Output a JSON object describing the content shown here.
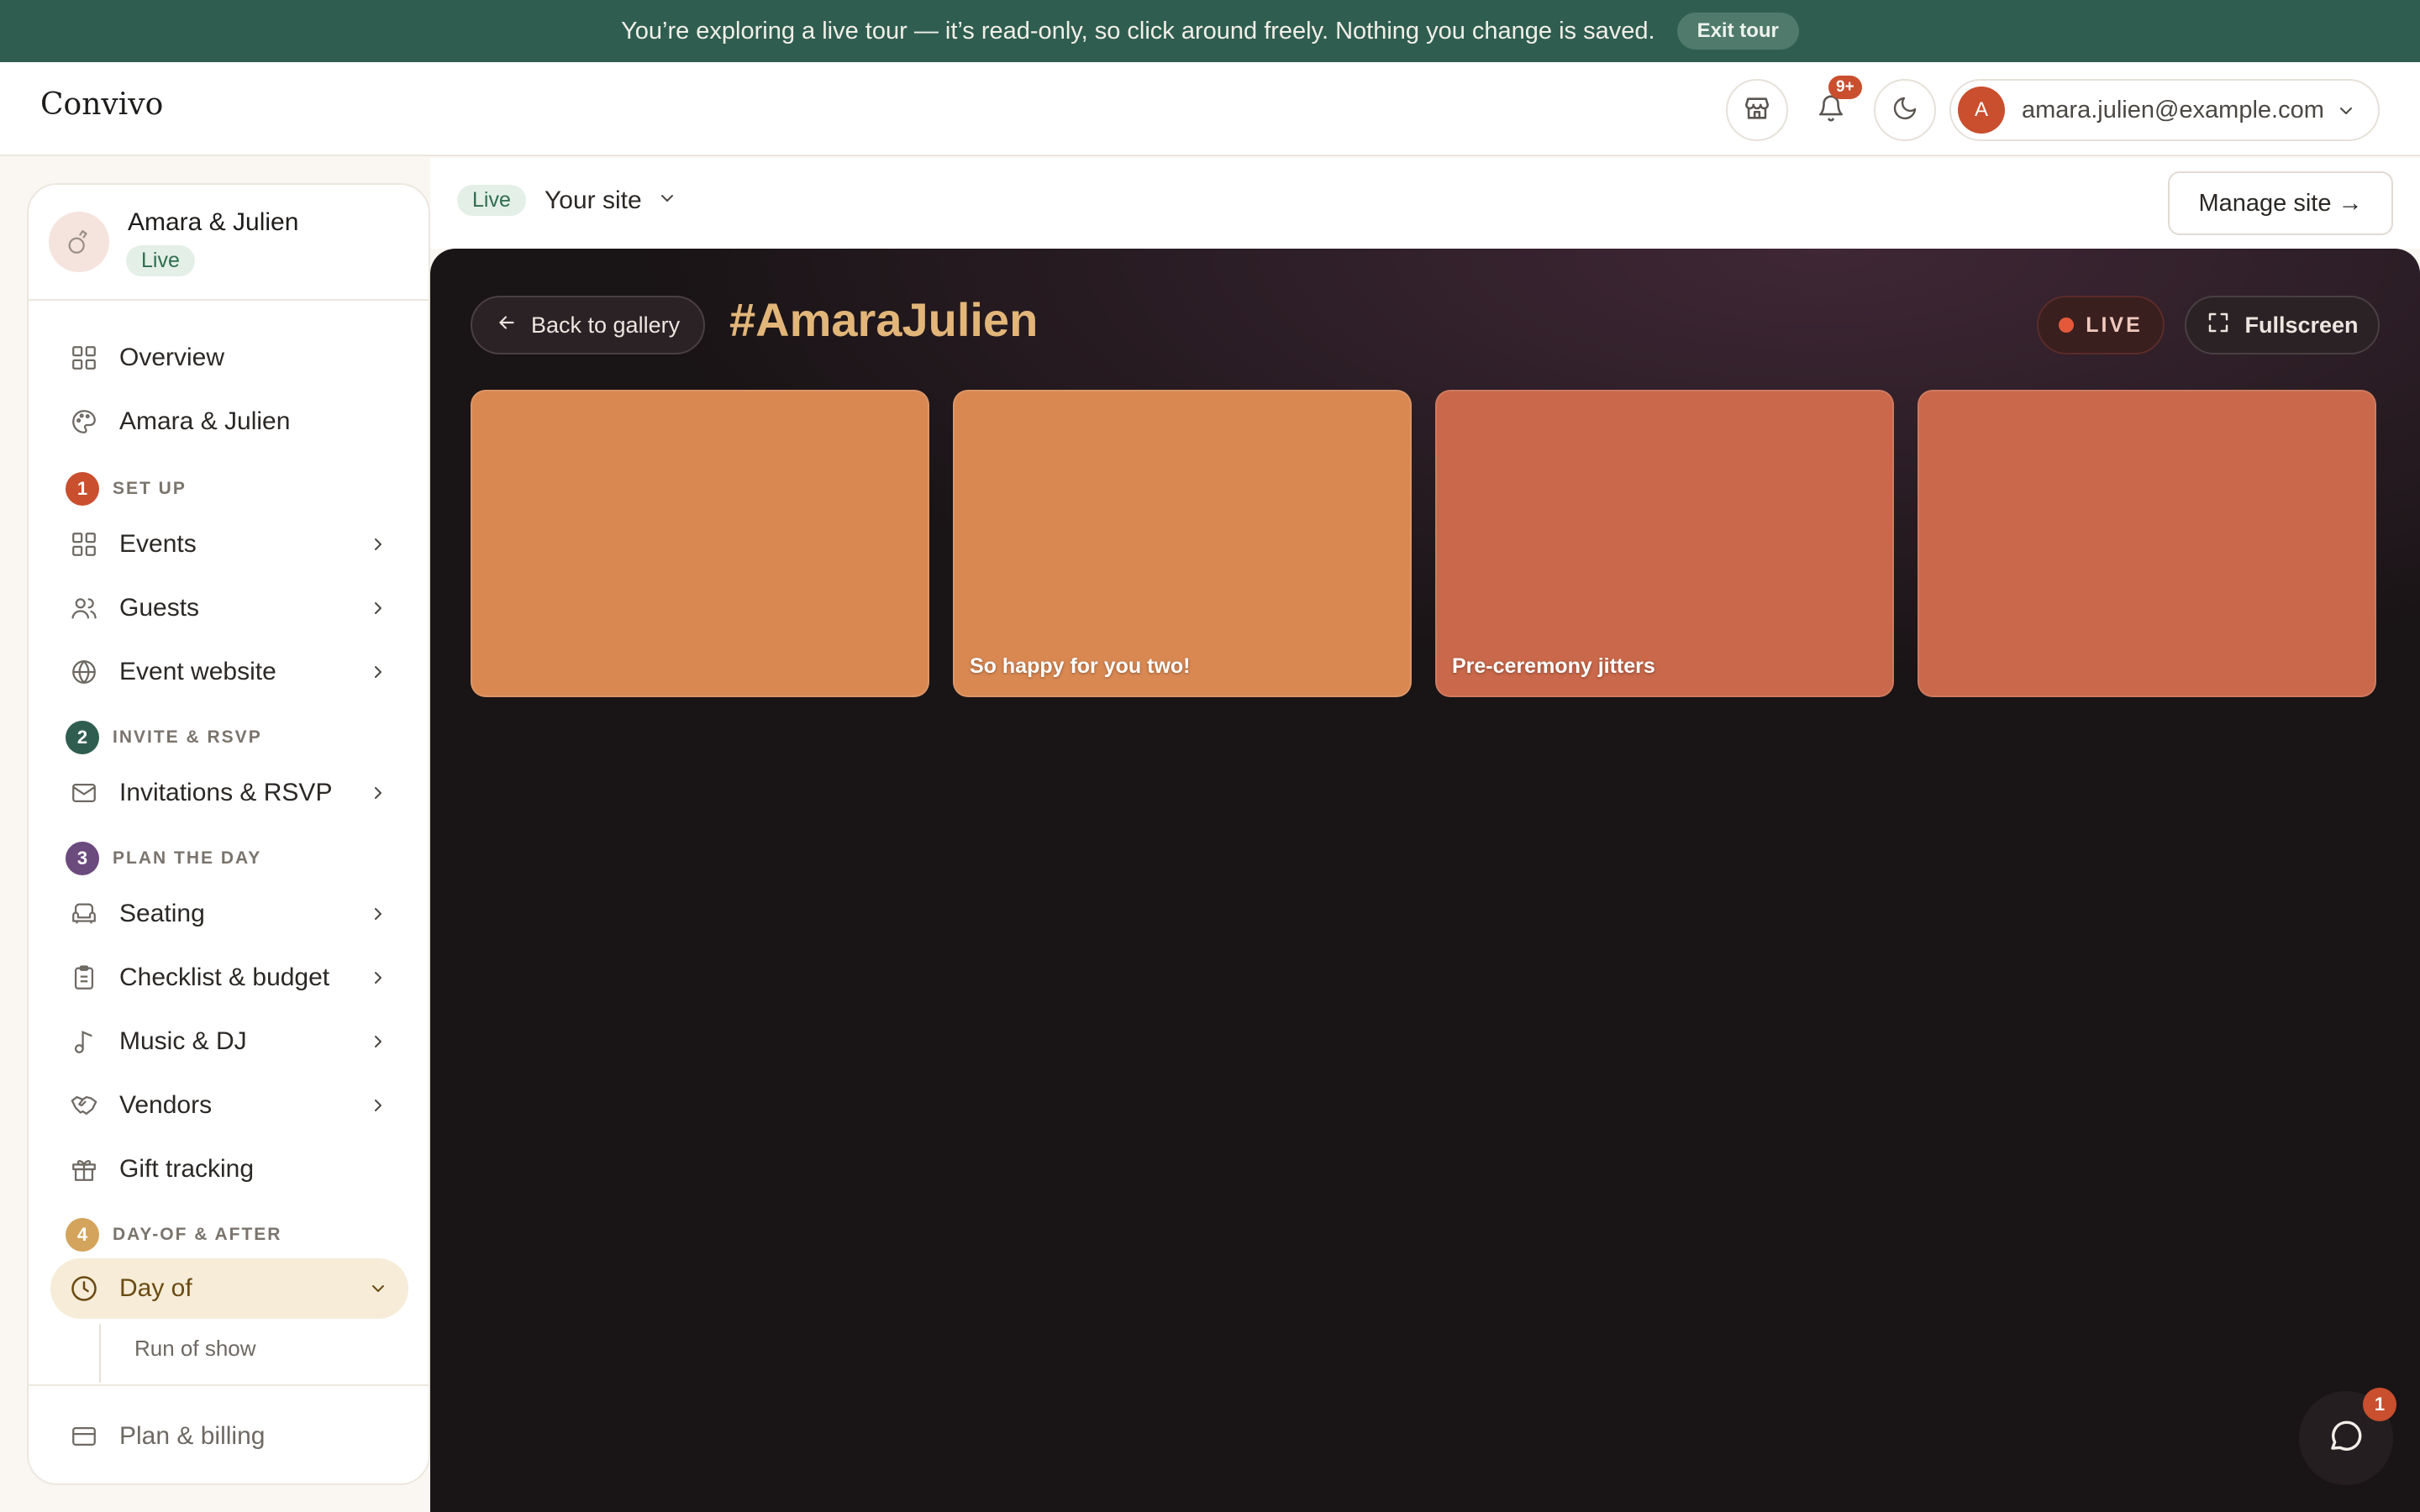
{
  "banner": {
    "text": "You’re exploring a live tour — it’s read-only, so click around freely. Nothing you change is saved.",
    "exit_label": "Exit tour"
  },
  "header": {
    "logo": "Convivo",
    "notification_count": "9+",
    "account": {
      "avatar_letter": "A",
      "email": "amara.julien@example.com"
    },
    "icons": [
      "storefront-icon",
      "bell-icon",
      "moon-icon",
      "chevron-down-icon"
    ]
  },
  "sidebar": {
    "project": {
      "name": "Amara & Julien",
      "status": "Live"
    },
    "top_items": [
      {
        "label": "Overview",
        "icon": "grid-icon"
      },
      {
        "label": "Amara & Julien",
        "icon": "palette-icon"
      }
    ],
    "sections": [
      {
        "number": "1",
        "label": "SET UP",
        "color": "#c94f2e"
      },
      {
        "number": "2",
        "label": "INVITE & RSVP",
        "color": "#2f5e50"
      },
      {
        "number": "3",
        "label": "PLAN THE DAY",
        "color": "#6b4a7e"
      },
      {
        "number": "4",
        "label": "DAY-OF & AFTER",
        "color": "#d4a45c"
      }
    ],
    "items": {
      "events": "Events",
      "guests": "Guests",
      "event_website": "Event website",
      "invitations": "Invitations & RSVP",
      "seating": "Seating",
      "checklist": "Checklist & budget",
      "music": "Music & DJ",
      "vendors": "Vendors",
      "gifts": "Gift tracking",
      "day_of": "Day of",
      "run_of_show": "Run of show",
      "billing": "Plan & billing"
    }
  },
  "topbar": {
    "status": "Live",
    "site_selector": "Your site",
    "manage_label": "Manage site →"
  },
  "live_wall": {
    "back_label": "Back to gallery",
    "hashtag": "#AmaraJulien",
    "live_label": "LIVE",
    "fullscreen_label": "Fullscreen",
    "tiles": [
      {
        "caption": "",
        "color": "#d98852"
      },
      {
        "caption": "So happy for you two!",
        "color": "#d98852"
      },
      {
        "caption": "Pre-ceremony jitters",
        "color": "#c9684a"
      },
      {
        "caption": "",
        "color": "#c9684a"
      }
    ]
  },
  "chat": {
    "unread": "1"
  }
}
